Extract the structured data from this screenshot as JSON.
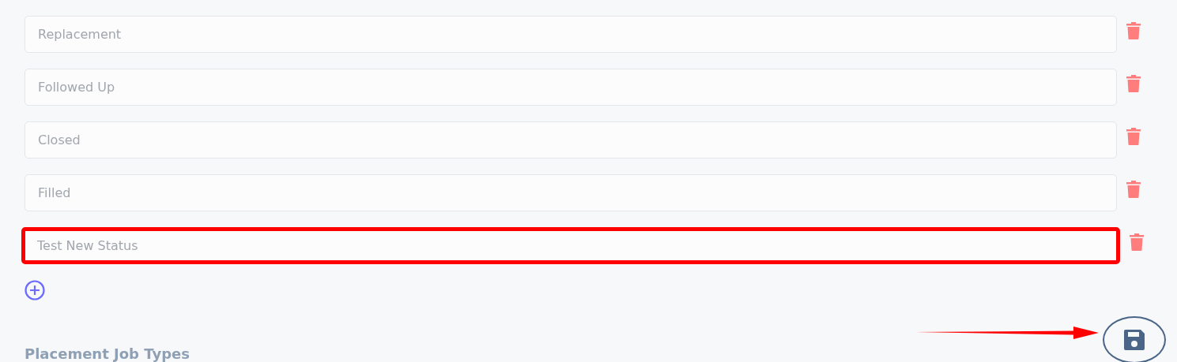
{
  "statuses": [
    {
      "value": "Replacement",
      "highlighted": false
    },
    {
      "value": "Followed Up",
      "highlighted": false
    },
    {
      "value": "Closed",
      "highlighted": false
    },
    {
      "value": "Filled",
      "highlighted": false
    },
    {
      "value": "Test New Status",
      "highlighted": true
    }
  ],
  "section_heading": "Placement Job Types",
  "annotations": [
    {
      "kind": "arrow"
    }
  ]
}
